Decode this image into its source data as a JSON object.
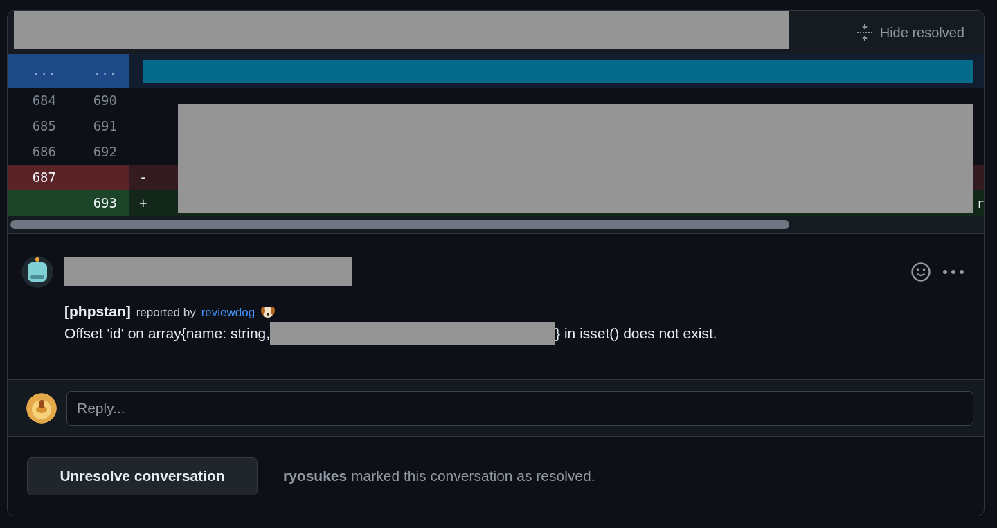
{
  "header": {
    "hide_resolved": "Hide resolved"
  },
  "hunk": {
    "old": "...",
    "new": "..."
  },
  "lines": [
    {
      "kind": "context",
      "old": "684",
      "new": "690"
    },
    {
      "kind": "context",
      "old": "685",
      "new": "691"
    },
    {
      "kind": "context",
      "old": "686",
      "new": "692"
    },
    {
      "kind": "deletion",
      "old": "687",
      "sign": "-"
    },
    {
      "kind": "addition",
      "new": "693",
      "sign": "+",
      "code": "r"
    }
  ],
  "comment": {
    "tool": "[phpstan]",
    "reported_by": "reported by",
    "bot": "reviewdog",
    "message_before": "Offset 'id' on array{name: string,",
    "message_after": "} in isset() does not exist."
  },
  "reply": {
    "placeholder": "Reply..."
  },
  "footer": {
    "button": "Unresolve conversation",
    "status": "**ryosukes** marked this conversation as resolved."
  }
}
